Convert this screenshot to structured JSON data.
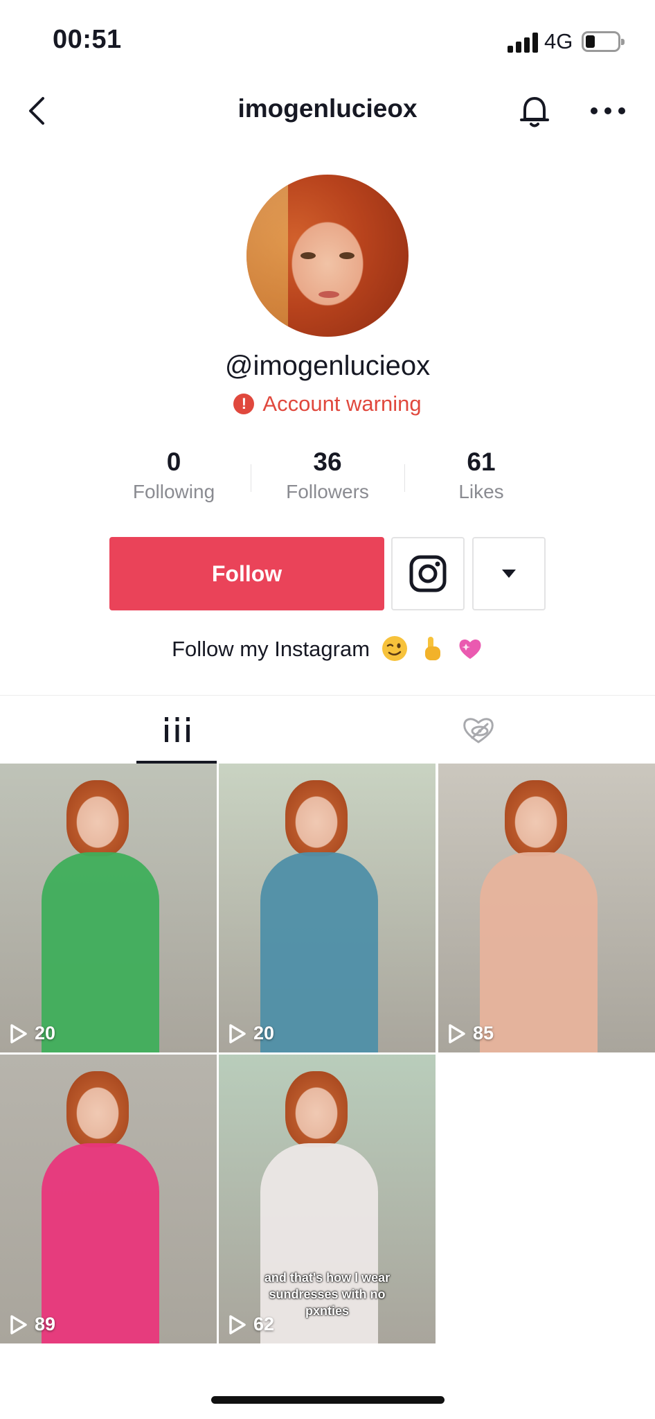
{
  "status_bar": {
    "time": "00:51",
    "network": "4G",
    "battery_level": 0.3
  },
  "header": {
    "title": "imogenlucieox"
  },
  "profile": {
    "handle": "@imogenlucieox",
    "warning": "Account warning",
    "stats": [
      {
        "value": "0",
        "label": "Following"
      },
      {
        "value": "36",
        "label": "Followers"
      },
      {
        "value": "61",
        "label": "Likes"
      }
    ],
    "follow_label": "Follow",
    "bio": "Follow my Instagram"
  },
  "tabs": [
    {
      "icon": "videos-grid-icon",
      "active": true
    },
    {
      "icon": "liked-hidden-icon",
      "active": false
    }
  ],
  "videos": [
    {
      "views": "20",
      "bg": "#bfc3b8",
      "outfit": "#3fae5b"
    },
    {
      "views": "20",
      "bg": "#c9d3c2",
      "outfit": "#4f8fa8"
    },
    {
      "views": "85",
      "bg": "#cbc7be",
      "outfit": "#e7b39c"
    },
    {
      "views": "89",
      "bg": "#b7b4ac",
      "outfit": "#e9367b"
    },
    {
      "views": "62",
      "bg": "#b9cdbb",
      "outfit": "#ece7e6",
      "caption": "and that's how I wear sundresses with no pxnties"
    }
  ],
  "colors": {
    "accent": "#ea4359",
    "warning": "#e0483d",
    "text": "#161823",
    "muted": "#8a8b91"
  }
}
